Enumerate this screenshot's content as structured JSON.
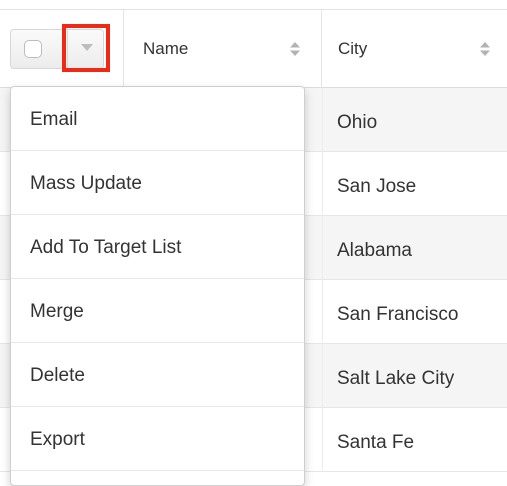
{
  "header": {
    "columns": [
      {
        "label": "Name"
      },
      {
        "label": "City"
      }
    ]
  },
  "rows": [
    {
      "city": "Ohio"
    },
    {
      "city": "San Jose"
    },
    {
      "city": "Alabama"
    },
    {
      "city": "San Francisco"
    },
    {
      "city": "Salt Lake City"
    },
    {
      "city": "Santa Fe"
    }
  ],
  "mass_actions_menu": {
    "items": [
      {
        "label": "Email"
      },
      {
        "label": "Mass Update"
      },
      {
        "label": "Add To Target List"
      },
      {
        "label": "Merge"
      },
      {
        "label": "Delete"
      },
      {
        "label": "Export"
      }
    ]
  },
  "colors": {
    "highlight_box": "#ee2a14",
    "alt_row": "#f5f5f5"
  },
  "icons": {
    "sort": "sort-icon",
    "caret": "chevron-down-icon"
  }
}
